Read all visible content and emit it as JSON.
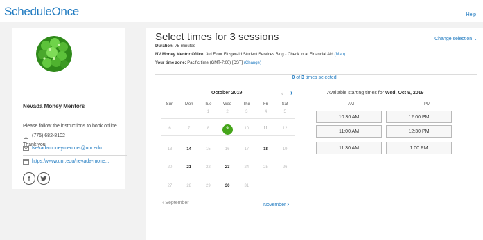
{
  "header": {
    "logo_text": "ScheduleOnce",
    "help_label": "Help"
  },
  "sidebar": {
    "org_name": "Nevada Money Mentors",
    "instructions": "Please follow the instructions to book online.",
    "thanks": "Thank you.",
    "phone": "(775) 682-8102",
    "email": "Nevadamoneymentors@unr.edu",
    "website": "https://www.unr.edu/nevada-mone...",
    "social": [
      "facebook-icon",
      "twitter-icon"
    ]
  },
  "main": {
    "title": "Select times for 3 sessions",
    "change_selection": "Change selection",
    "duration_label": "Duration:",
    "duration_value": "75 minutes",
    "location_label": "NV Money Mentor Office:",
    "location_value": "3rd Floor Fitzgerald Student Services Bldg - Check in at Financial Aid",
    "map_link": "(Map)",
    "timezone_label": "Your time zone:",
    "timezone_value": "Pacific time  (GMT-7:00) [DST]",
    "timezone_change": "(Change)",
    "selected_count": "0",
    "selected_of": " of ",
    "selected_total": "3",
    "selected_suffix": " times selected"
  },
  "calendar": {
    "month_label": "October 2019",
    "prev_month_label": "September",
    "next_month_label": "November",
    "weekdays": [
      "Sun",
      "Mon",
      "Tue",
      "Wed",
      "Thu",
      "Fri",
      "Sat"
    ],
    "weeks": [
      [
        {
          "d": "",
          "s": ""
        },
        {
          "d": "",
          "s": ""
        },
        {
          "d": "1",
          "s": "dim"
        },
        {
          "d": "2",
          "s": "dim"
        },
        {
          "d": "3",
          "s": "dim"
        },
        {
          "d": "4",
          "s": "dim"
        },
        {
          "d": "5",
          "s": "dim"
        }
      ],
      [
        {
          "d": "6",
          "s": "dim"
        },
        {
          "d": "7",
          "s": "dim"
        },
        {
          "d": "8",
          "s": "dim"
        },
        {
          "d": "9",
          "s": "sel"
        },
        {
          "d": "10",
          "s": "dim"
        },
        {
          "d": "11",
          "s": "avail"
        },
        {
          "d": "12",
          "s": "dim"
        }
      ],
      [
        {
          "d": "13",
          "s": "dim"
        },
        {
          "d": "14",
          "s": "avail"
        },
        {
          "d": "15",
          "s": "dim"
        },
        {
          "d": "16",
          "s": "dim"
        },
        {
          "d": "17",
          "s": "dim"
        },
        {
          "d": "18",
          "s": "avail"
        },
        {
          "d": "19",
          "s": "dim"
        }
      ],
      [
        {
          "d": "20",
          "s": "dim"
        },
        {
          "d": "21",
          "s": "avail"
        },
        {
          "d": "22",
          "s": "dim"
        },
        {
          "d": "23",
          "s": "avail"
        },
        {
          "d": "24",
          "s": "dim"
        },
        {
          "d": "25",
          "s": "dim"
        },
        {
          "d": "26",
          "s": "dim"
        }
      ],
      [
        {
          "d": "27",
          "s": "dim"
        },
        {
          "d": "28",
          "s": "dim"
        },
        {
          "d": "29",
          "s": "dim"
        },
        {
          "d": "30",
          "s": "avail"
        },
        {
          "d": "31",
          "s": "dim"
        },
        {
          "d": "",
          "s": ""
        },
        {
          "d": "",
          "s": ""
        }
      ]
    ]
  },
  "times": {
    "title_prefix": "Available starting times for ",
    "title_date": "Wed, Oct 9, 2019",
    "am_label": "AM",
    "pm_label": "PM",
    "am": [
      "10:30 AM",
      "11:00 AM",
      "11:30 AM"
    ],
    "pm": [
      "12:00 PM",
      "12:30 PM",
      "1:00 PM"
    ]
  },
  "colors": {
    "accent": "#1f7ac0",
    "selected_day": "#45a51a"
  }
}
